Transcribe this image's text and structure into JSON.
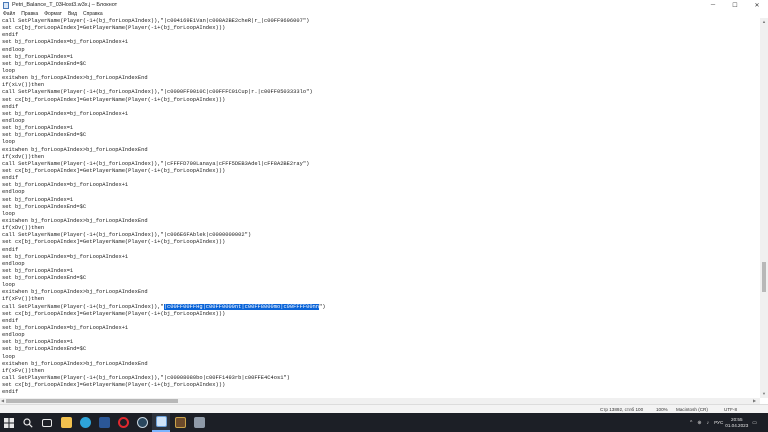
{
  "window": {
    "title": "Petri_Balance_T_03Host3.w3x.j – Блокнот",
    "minimize_symbol": "─",
    "maximize_symbol": "☐",
    "close_symbol": "✕"
  },
  "menu": [
    "Файл",
    "Правка",
    "Формат",
    "Вид",
    "Справка"
  ],
  "code_lines": [
    "call SetPlayerName(Player(-1+(bj_forLoopAIndex)),\"|c004169E1Van|c008A2BE2cheR|r_|c00FF9696007\")",
    "set cx[bj_forLoopAIndex]=GetPlayerName(Player(-1+(bj_forLoopAIndex)))",
    "endif",
    "set bj_forLoopAIndex=bj_forLoopAIndex+1",
    "endloop",
    "set bj_forLoopAIndex=1",
    "set bj_forLoopAIndexEnd=$C",
    "loop",
    "exitwhen bj_forLoopAIndex>bj_forLoopAIndexEnd",
    "if(xLv())then",
    "call SetPlayerName(Player(-1+(bj_forLoopAIndex)),\"|c0000FF00i0C|c00FFFC01Cup|r.|c00FF0503333lo\")",
    "set cx[bj_forLoopAIndex]=GetPlayerName(Player(-1+(bj_forLoopAIndex)))",
    "endif",
    "set bj_forLoopAIndex=bj_forLoopAIndex+1",
    "endloop",
    "set bj_forLoopAIndex=1",
    "set bj_forLoopAIndexEnd=$C",
    "loop",
    "exitwhen bj_forLoopAIndex>bj_forLoopAIndexEnd",
    "if(xdv())then",
    "call SetPlayerName(Player(-1+(bj_forLoopAIndex)),\"|cFFFFD700Lanaya|cFFF5DEB3Adel|cFF8A2BE2ray\")",
    "set cx[bj_forLoopAIndex]=GetPlayerName(Player(-1+(bj_forLoopAIndex)))",
    "endif",
    "set bj_forLoopAIndex=bj_forLoopAIndex+1",
    "endloop",
    "set bj_forLoopAIndex=1",
    "set bj_forLoopAIndexEnd=$C",
    "loop",
    "exitwhen bj_forLoopAIndex>bj_forLoopAIndexEnd",
    "if(xDv())then",
    "call SetPlayerName(Player(-1+(bj_forLoopAIndex)),\"|c006E6FAblek|c0000000002\")",
    "set cx[bj_forLoopAIndex]=GetPlayerName(Player(-1+(bj_forLoopAIndex)))",
    "endif",
    "set bj_forLoopAIndex=bj_forLoopAIndex+1",
    "endloop",
    "set bj_forLoopAIndex=1",
    "set bj_forLoopAIndexEnd=$C",
    "loop",
    "exitwhen bj_forLoopAIndex>bj_forLoopAIndexEnd",
    "if(xFv())then",
    "@HL@",
    "set cx[bj_forLoopAIndex]=GetPlayerName(Player(-1+(bj_forLoopAIndex)))",
    "endif",
    "set bj_forLoopAIndex=bj_forLoopAIndex+1",
    "endloop",
    "set bj_forLoopAIndex=1",
    "set bj_forLoopAIndexEnd=$C",
    "loop",
    "exitwhen bj_forLoopAIndex>bj_forLoopAIndexEnd",
    "if(xFv())then",
    "call SetPlayerName(Player(-1+(bj_forLoopAIndex)),\"|c00008080bo|c00FF1493rb|c00FFE4C4os1\")",
    "set cx[bj_forLoopAIndex]=GetPlayerName(Player(-1+(bj_forLoopAIndex)))",
    "endif"
  ],
  "highlighted_line": {
    "before": "call SetPlayerName(Player(-1+(bj_forLoopAIndex)),\"",
    "selected": "|c00FF00FFHg|c00FF0000nt|c00FF8000mo|c00FFFF00nn",
    "after": "\")"
  },
  "status": {
    "position": "Стр 13892, стлб 100",
    "zoom": "100%",
    "line_endings": "Macintosh (CR)",
    "encoding": "UTF-8"
  },
  "taskbar": {
    "search_icon": "search-icon",
    "apps": [
      "task-view-icon",
      "explorer-icon",
      "edge-icon",
      "word-icon",
      "opera-icon",
      "steam-icon",
      "notepad-icon",
      "warcraft-icon",
      "text-editor-icon"
    ],
    "tray_lang": "РУС",
    "time": "20:55",
    "date": "01.04.2023"
  },
  "colors": {
    "selection": "#0a64d8",
    "taskbar": "#1c1f26"
  }
}
